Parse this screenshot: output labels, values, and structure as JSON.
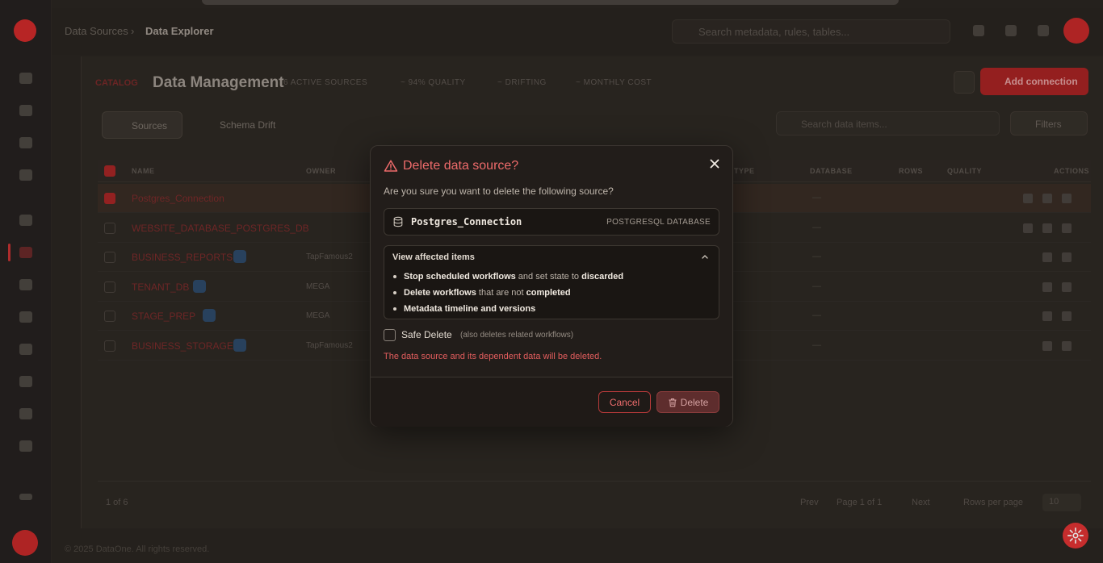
{
  "header": {
    "breadcrumb": [
      "Data Sources",
      "Data Explorer"
    ],
    "search_placeholder": "Search metadata, rules, tables..."
  },
  "panel": {
    "kicker": "CATALOG",
    "title": "Data Management",
    "stats": [
      "6 ACTIVE SOURCES",
      "~ 94% QUALITY",
      "~ DRIFTING",
      "~ MONTHLY COST"
    ],
    "add_label": "Add connection",
    "tabs": [
      "Sources",
      "Schema Drift"
    ],
    "table_search_placeholder": "Search data items...",
    "filters_label": "Filters",
    "columns": [
      "NAME",
      "OWNER",
      "TYPE",
      "DATABASE",
      "ROWS",
      "QUALITY",
      "ACTIONS"
    ],
    "rows": [
      {
        "name": "Postgres_Connection",
        "owner": "",
        "selected": true
      },
      {
        "name": "WEBSITE_DATABASE_POSTGRES_DB",
        "owner": "",
        "selected": false
      },
      {
        "name": "BUSINESS_REPORTS",
        "owner": "TapFamous2",
        "selected": false
      },
      {
        "name": "TENANT_DB",
        "owner": "MEGA",
        "selected": false
      },
      {
        "name": "STAGE_PREP",
        "owner": "MEGA",
        "selected": false
      },
      {
        "name": "BUSINESS_STORAGE",
        "owner": "TapFamous2",
        "selected": false
      }
    ],
    "footer_count": "1 of 6",
    "footer_prev": "Prev",
    "footer_page": "Page 1 of 1",
    "footer_next": "Next",
    "footer_rows_label": "Rows per page",
    "footer_rows_value": "10"
  },
  "copyright": "© 2025 DataOne. All rights reserved.",
  "modal": {
    "title": "Delete data source?",
    "subtitle": "Are you sure you want to delete the following source?",
    "source_name": "Postgres_Connection",
    "source_type": "POSTGRESQL DATABASE",
    "affected_heading": "View affected items",
    "affected_items": [
      {
        "bold": "Stop scheduled workflows",
        "mid": " and set state to ",
        "bold2": "discarded"
      },
      {
        "bold": "Delete workflows",
        "mid": " that are not ",
        "bold2": "completed"
      },
      {
        "bold": "Metadata timeline and versions",
        "mid": "",
        "bold2": ""
      }
    ],
    "safe_delete_label": "Safe Delete",
    "safe_delete_note": "(also deletes related workflows)",
    "warning": "The data source and its dependent data will be deleted.",
    "cancel_label": "Cancel",
    "delete_label": "Delete"
  },
  "colors": {
    "accent": "#e23434",
    "danger_text": "#ee6b6b",
    "modal_bg": "#221d1a"
  }
}
